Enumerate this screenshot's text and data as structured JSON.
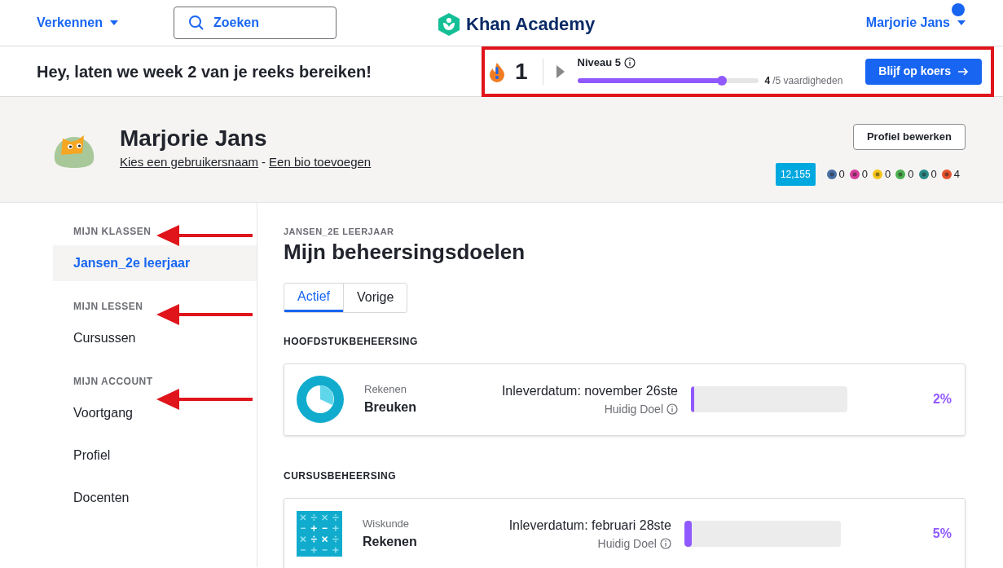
{
  "nav": {
    "explore": "Verkennen",
    "search": {
      "placeholder": "Zoeken"
    },
    "logo": "Khan Academy",
    "user": "Marjorie Jans",
    "notification": true
  },
  "streak_bar": {
    "message": "Hey, laten we week 2 van je reeks bereiken!",
    "streak": "1",
    "level_label": "Niveau 5",
    "level": 0.8,
    "done": "4",
    "total": "/5 vaardigheden",
    "button": "Blijf op koers"
  },
  "profile": {
    "name": "Marjorie Jans",
    "username_link": "Kies een gebruikersnaam",
    "separator": "-",
    "bio_link": "Een bio toevoegen",
    "edit_button": "Profiel bewerken",
    "points": "12,155",
    "badges": [
      {
        "count": "0",
        "color": "#4a6fa5"
      },
      {
        "count": "0",
        "color": "#d63d9b"
      },
      {
        "count": "0",
        "color": "#f5c518"
      },
      {
        "count": "0",
        "color": "#4caf50"
      },
      {
        "count": "0",
        "color": "#2a8a8a"
      },
      {
        "count": "4",
        "color": "#e5532d"
      }
    ]
  },
  "sidebar": [
    {
      "heading": "MIJN KLASSEN",
      "items": [
        {
          "label": "Jansen_2e leerjaar",
          "selected": true
        }
      ]
    },
    {
      "heading": "MIJN LESSEN",
      "items": [
        {
          "label": "Cursussen",
          "selected": false
        }
      ]
    },
    {
      "heading": "MIJN ACCOUNT",
      "items": [
        {
          "label": "Voortgang",
          "selected": false
        },
        {
          "label": "Profiel",
          "selected": false
        },
        {
          "label": "Docenten",
          "selected": false
        }
      ]
    }
  ],
  "content": {
    "class_label": "JANSEN_2E LEERJAAR",
    "title": "Mijn beheersingsdoelen",
    "tabs": [
      {
        "label": "Actief",
        "selected": true
      },
      {
        "label": "Vorige",
        "selected": false
      }
    ],
    "sections": [
      {
        "heading": "HOOFDSTUKBEHEERSING",
        "goals": [
          {
            "kind": "pie",
            "subject": "Rekenen",
            "name": "Breuken",
            "due": "Inleverdatum: november 26ste",
            "goal_label": "Huidig Doel",
            "level": 0.02,
            "percent": "2%"
          }
        ]
      },
      {
        "heading": "CURSUSBEHEERSING",
        "goals": [
          {
            "kind": "math",
            "subject": "Wiskunde",
            "name": "Rekenen",
            "due": "Inleverdatum: februari 28ste",
            "goal_label": "Huidig Doel",
            "level": 0.05,
            "percent": "5%"
          }
        ]
      }
    ]
  }
}
